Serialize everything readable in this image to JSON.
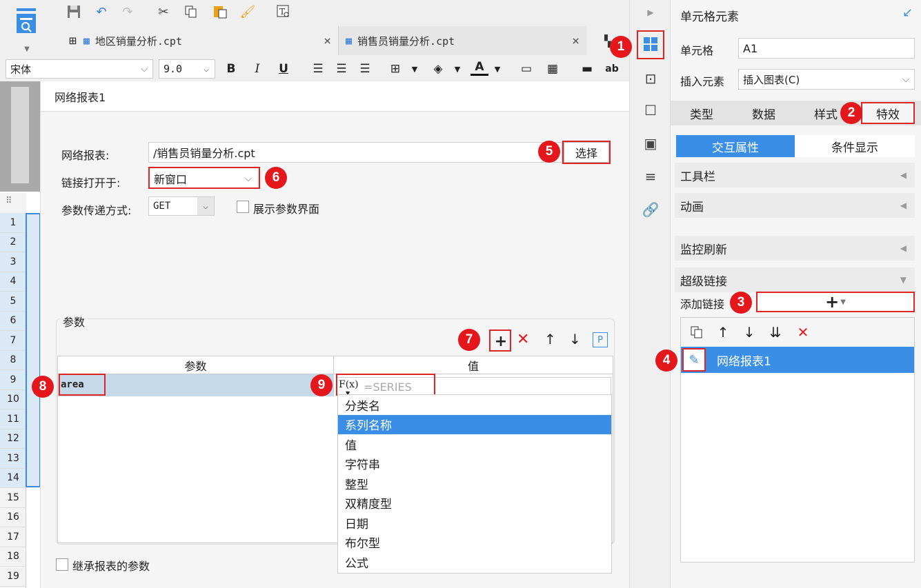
{
  "tabs": [
    {
      "label": "地区销量分析.cpt"
    },
    {
      "label": "销售员销量分析.cpt"
    }
  ],
  "format": {
    "font_name": "宋体",
    "font_size": "9.0",
    "bold": "B",
    "italic": "I",
    "underline": "U",
    "font_color_glyph": "A",
    "ab_label": "ab"
  },
  "rows": [
    "1",
    "2",
    "3",
    "4",
    "5",
    "6",
    "7",
    "8",
    "9",
    "10",
    "11",
    "12",
    "13",
    "14",
    "15",
    "16",
    "17",
    "18",
    "19"
  ],
  "dialog": {
    "title": "网络报表1",
    "report_label": "网络报表:",
    "report_value": "/销售员销量分析.cpt",
    "choose_button": "选择",
    "open_in_label": "链接打开于:",
    "open_in_value": "新窗口",
    "param_mode_label": "参数传递方式:",
    "param_mode_value": "GET",
    "show_param_label": "展示参数界面",
    "params_group_label": "参数",
    "col_param": "参数",
    "col_value": "值",
    "param_name": "area",
    "value_placeholder": "=SERIES",
    "fx_glyph": "F(x)",
    "p_glyph": "P",
    "inherit_label": "继承报表的参数",
    "options": [
      "分类名",
      "系列名称",
      "值",
      "字符串",
      "整型",
      "双精度型",
      "日期",
      "布尔型",
      "公式"
    ],
    "selected_option": "系列名称"
  },
  "panel": {
    "title": "单元格元素",
    "cell_label": "单元格",
    "cell_value": "A1",
    "insert_label": "插入元素",
    "insert_value": "插入图表(C)",
    "tabs": [
      "类型",
      "数据",
      "样式",
      "特效"
    ],
    "subtabs": [
      "交互属性",
      "条件显示"
    ],
    "sections": [
      "工具栏",
      "动画",
      "监控刷新",
      "超级链接"
    ],
    "add_link_label": "添加链接",
    "add_link_glyph": "+",
    "link_item": "网络报表1"
  },
  "badges": [
    "1",
    "2",
    "3",
    "4",
    "5",
    "6",
    "7",
    "8",
    "9"
  ],
  "colors": {
    "accent": "#3a8ee6",
    "badge": "#e4181c",
    "highlight_box": "#e02424",
    "row_selected": "#c5d9ea"
  }
}
